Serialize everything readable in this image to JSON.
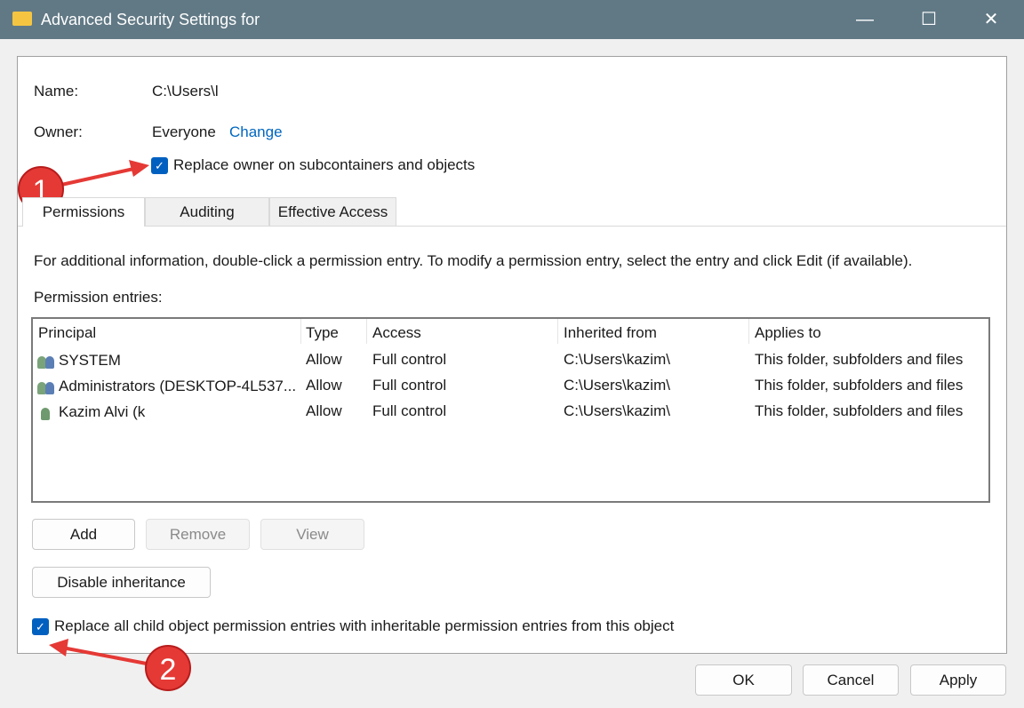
{
  "window": {
    "title": "Advanced Security Settings for",
    "minimize": "—",
    "maximize": "☐",
    "close": "✕"
  },
  "name_label": "Name:",
  "name_value": "C:\\Users\\l",
  "owner_label": "Owner:",
  "owner_value": "Everyone",
  "owner_change": "Change",
  "replace_owner": {
    "label": "Replace owner on subcontainers and objects",
    "checked": true
  },
  "tabs": [
    {
      "label": "Permissions",
      "active": true
    },
    {
      "label": "Auditing"
    },
    {
      "label": "Effective Access"
    }
  ],
  "info_text": "For additional information, double-click a permission entry. To modify a permission entry, select the entry and click Edit (if available).",
  "entries_label": "Permission entries:",
  "columns": [
    "Principal",
    "Type",
    "Access",
    "Inherited from",
    "Applies to"
  ],
  "rows": [
    {
      "principal": "SYSTEM",
      "icon": "group-users-icon",
      "type": "Allow",
      "access": "Full control",
      "inherited": "C:\\Users\\kazim\\",
      "applies": "This folder, subfolders and files"
    },
    {
      "principal": "Administrators (DESKTOP-4L537...",
      "icon": "group-users-icon",
      "type": "Allow",
      "access": "Full control",
      "inherited": "C:\\Users\\kazim\\",
      "applies": "This folder, subfolders and files"
    },
    {
      "principal": "Kazim Alvi (k",
      "icon": "user-icon",
      "type": "Allow",
      "access": "Full control",
      "inherited": "C:\\Users\\kazim\\",
      "applies": "This folder, subfolders and files"
    }
  ],
  "buttons": {
    "add": "Add",
    "remove": "Remove",
    "view": "View",
    "disable_inheritance": "Disable inheritance",
    "ok": "OK",
    "cancel": "Cancel",
    "apply": "Apply"
  },
  "replace_child": {
    "label": "Replace all child object permission entries with inheritable permission entries from this object",
    "checked": true
  },
  "annotations": [
    "1",
    "2"
  ],
  "colors": {
    "accent": "#0060c0",
    "titlebar": "#617985",
    "annotation": "#e53935"
  }
}
